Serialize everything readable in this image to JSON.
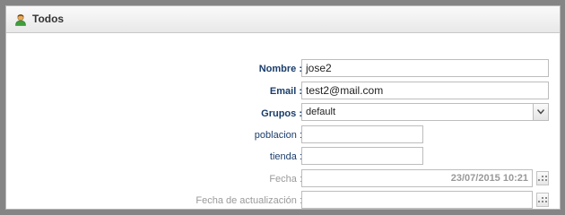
{
  "panel": {
    "title": "Todos",
    "icon": "user-icon"
  },
  "form": {
    "nombre": {
      "label": "Nombre :",
      "value": "jose2"
    },
    "email": {
      "label": "Email :",
      "value": "test2@mail.com"
    },
    "grupos": {
      "label": "Grupos :",
      "value": "default",
      "options_visible": [
        "default"
      ]
    },
    "poblacion": {
      "label": "poblacion :",
      "value": ""
    },
    "tienda": {
      "label": "tienda :",
      "value": ""
    },
    "fecha": {
      "label": "Fecha :",
      "value": "23/07/2015 10:21"
    },
    "fecha_actualizacion": {
      "label": "Fecha de actualización :",
      "value": ""
    }
  },
  "colors": {
    "background": "#858585",
    "label_accent": "#1a3d6b",
    "muted": "#9a9a9a"
  }
}
